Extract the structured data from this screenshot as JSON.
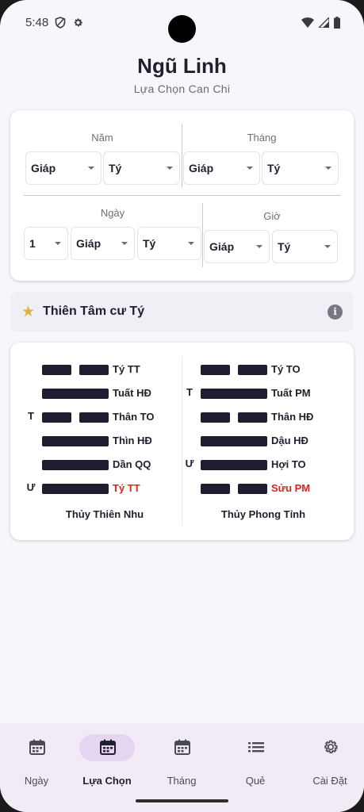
{
  "status": {
    "time": "5:48"
  },
  "header": {
    "title": "Ngũ Linh",
    "subtitle": "Lựa Chọn Can Chi"
  },
  "picker": {
    "nam": {
      "label": "Năm",
      "can": "Giáp",
      "chi": "Tý"
    },
    "thang": {
      "label": "Tháng",
      "can": "Giáp",
      "chi": "Tý"
    },
    "ngay": {
      "label": "Ngày",
      "day": "1",
      "can": "Giáp",
      "chi": "Tý"
    },
    "gio": {
      "label": "Giờ",
      "can": "Giáp",
      "chi": "Tý"
    }
  },
  "highlight": {
    "text": "Thiên Tâm cư Tý",
    "icon": "star-icon",
    "info_icon": "info-icon"
  },
  "hexagrams": [
    {
      "name": "Thủy Thiên Nhu",
      "lines": [
        {
          "type": "yin",
          "marker": "",
          "label": "Tý TT",
          "highlight": false
        },
        {
          "type": "yang",
          "marker": "",
          "label": "Tuất HĐ",
          "highlight": false
        },
        {
          "type": "yin",
          "marker": "T",
          "label": "Thân TO",
          "highlight": false
        },
        {
          "type": "yang",
          "marker": "",
          "label": "Thìn HĐ",
          "highlight": false
        },
        {
          "type": "yang",
          "marker": "",
          "label": "Dần QQ",
          "highlight": false
        },
        {
          "type": "yang",
          "marker": "Ư",
          "label": "Tý TT",
          "highlight": true
        }
      ]
    },
    {
      "name": "Thủy Phong Tỉnh",
      "lines": [
        {
          "type": "yin",
          "marker": "",
          "label": "Tý TO",
          "highlight": false
        },
        {
          "type": "yang",
          "marker": "T",
          "label": "Tuất PM",
          "highlight": false
        },
        {
          "type": "yin",
          "marker": "",
          "label": "Thân HĐ",
          "highlight": false
        },
        {
          "type": "yang",
          "marker": "",
          "label": "Dậu HĐ",
          "highlight": false
        },
        {
          "type": "yang",
          "marker": "Ư",
          "label": "Hợi TO",
          "highlight": false
        },
        {
          "type": "yin",
          "marker": "",
          "label": "Sửu PM",
          "highlight": true
        }
      ]
    }
  ],
  "nav": [
    {
      "label": "Ngày",
      "icon": "calendar-icon",
      "active": false
    },
    {
      "label": "Lựa Chọn",
      "icon": "calendar-icon",
      "active": true
    },
    {
      "label": "Tháng",
      "icon": "calendar-icon",
      "active": false
    },
    {
      "label": "Quẻ",
      "icon": "list-icon",
      "active": false
    },
    {
      "label": "Cài Đặt",
      "icon": "gear-icon",
      "active": false
    }
  ],
  "colors": {
    "accent_red": "#e0221f",
    "bar": "#1e1e30",
    "star": "#e0b43a",
    "nav_active": "#e4d6f2"
  }
}
